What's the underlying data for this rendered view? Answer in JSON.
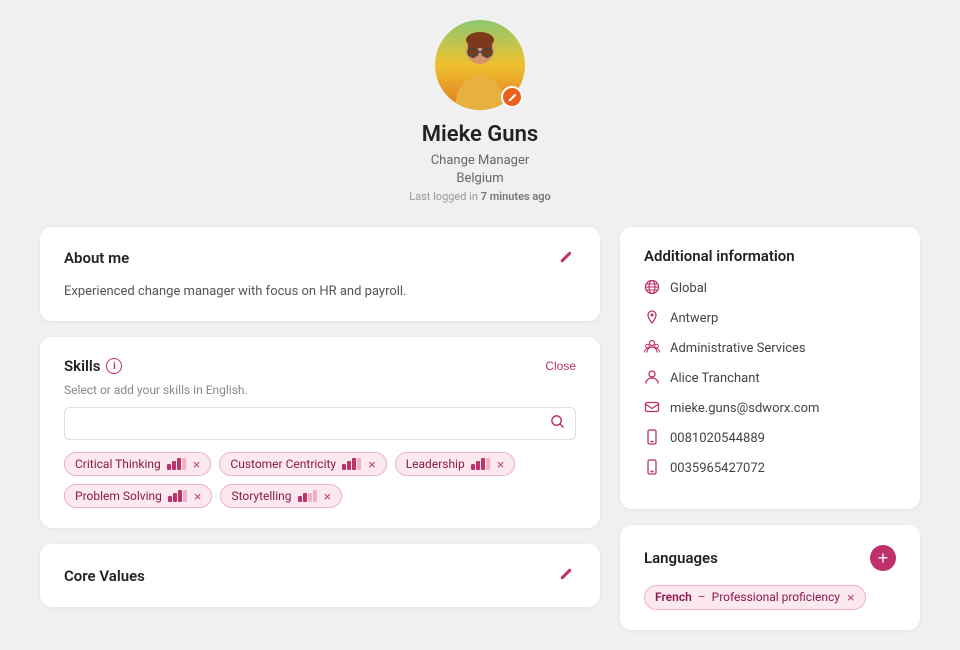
{
  "profile": {
    "name": "Mieke Guns",
    "title": "Change Manager",
    "country": "Belgium",
    "last_logged_label": "Last logged in",
    "last_logged_time": "7 minutes ago"
  },
  "about": {
    "section_title": "About me",
    "content": "Experienced change manager with focus on HR and payroll."
  },
  "skills": {
    "section_title": "Skills",
    "close_label": "Close",
    "placeholder_label": "Select or add your skills in English.",
    "items": [
      {
        "label": "Critical Thinking",
        "bars": [
          1,
          1,
          1,
          0
        ]
      },
      {
        "label": "Customer Centricity",
        "bars": [
          1,
          1,
          1,
          0
        ]
      },
      {
        "label": "Leadership",
        "bars": [
          1,
          1,
          1,
          0
        ]
      },
      {
        "label": "Problem Solving",
        "bars": [
          1,
          1,
          1,
          0
        ]
      },
      {
        "label": "Storytelling",
        "bars": [
          1,
          1,
          0,
          0
        ]
      }
    ]
  },
  "core_values": {
    "section_title": "Core Values"
  },
  "additional_info": {
    "section_title": "Additional information",
    "rows": [
      {
        "icon": "globe",
        "value": "Global"
      },
      {
        "icon": "pin",
        "value": "Antwerp"
      },
      {
        "icon": "org",
        "value": "Administrative Services"
      },
      {
        "icon": "user",
        "value": "Alice Tranchant"
      },
      {
        "icon": "mail",
        "value": "mieke.guns@sdworx.com"
      },
      {
        "icon": "phone",
        "value": "0081020544889"
      },
      {
        "icon": "phone2",
        "value": "0035965427072"
      }
    ]
  },
  "languages": {
    "section_title": "Languages",
    "add_icon": "+",
    "items": [
      {
        "name": "French",
        "level": "Professional proficiency"
      }
    ]
  }
}
